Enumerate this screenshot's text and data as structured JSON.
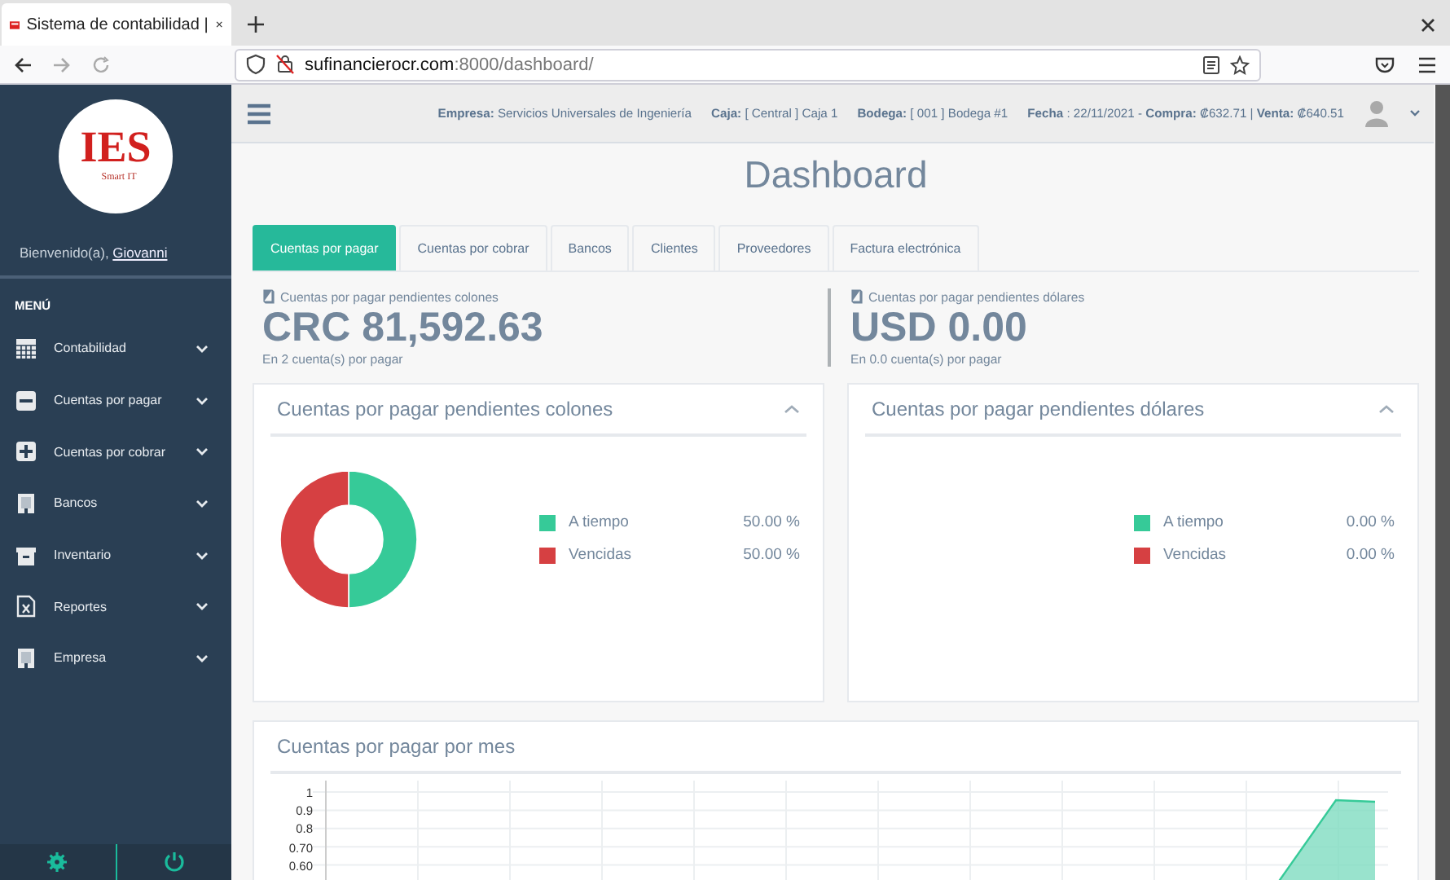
{
  "browser": {
    "tab_title": "Sistema de contabilidad |",
    "url_host": "sufinancierocr.com",
    "url_path": ":8000/dashboard/"
  },
  "sidebar": {
    "logo": {
      "title": "IES",
      "subtitle": "Smart IT"
    },
    "welcome": "Bienvenido(a),",
    "user": "Giovanni",
    "menu_heading": "MENÚ",
    "items": [
      {
        "label": "Contabilidad"
      },
      {
        "label": "Cuentas por pagar"
      },
      {
        "label": "Cuentas por cobrar"
      },
      {
        "label": "Bancos"
      },
      {
        "label": "Inventario"
      },
      {
        "label": "Reportes"
      },
      {
        "label": "Empresa"
      }
    ]
  },
  "header": {
    "info": [
      "**Empresa:** Servicios Universales de Ingeniería",
      "**Caja:** [ Central ] Caja 1",
      "**Bodega:** [ 001 ] Bodega #1",
      "**Fecha** : 22/11/2021 - **Compra:** ₡632.71 | **Venta:** ₡640.51"
    ]
  },
  "page_title": "Dashboard",
  "tabs": [
    {
      "label": "Cuentas por pagar",
      "selected": true
    },
    {
      "label": "Cuentas por cobrar",
      "selected": false
    },
    {
      "label": "Bancos",
      "selected": false
    },
    {
      "label": "Clientes",
      "selected": false
    },
    {
      "label": "Proveedores",
      "selected": false
    },
    {
      "label": "Factura electrónica",
      "selected": false
    }
  ],
  "stats": [
    {
      "label": "Cuentas por pagar pendientes colones",
      "value": "CRC 81,592.63",
      "note": "En 2 cuenta(s) por pagar"
    },
    {
      "label": "Cuentas por pagar pendientes dólares",
      "value": "USD 0.00",
      "note": "En 0.0 cuenta(s) por pagar"
    }
  ],
  "panels": [
    {
      "title": "Cuentas por pagar pendientes colones",
      "legend": [
        {
          "value": "50.00 %",
          "color": "#36ca98"
        },
        {
          "value": "50.00 %",
          "color": "#d64042"
        }
      ],
      "chart_data": {
        "type": "donut",
        "categories": [
          "A tiempo",
          "Vencidas"
        ],
        "values": [
          50,
          50
        ]
      }
    },
    {
      "title": "Cuentas por pagar pendientes dólares",
      "legend": [
        {
          "label": "A tiempo",
          "value": "0.00 %",
          "color": "#36ca98"
        },
        {
          "label": "Vencidas",
          "value": "0.00 %",
          "color": "#d64042"
        }
      ]
    }
  ],
  "monthly": {
    "title": "Cuentas por pagar por mes",
    "y_tick_labels": [
      "1",
      "0.9",
      "0.8",
      "0.70",
      "0.60"
    ]
  }
}
